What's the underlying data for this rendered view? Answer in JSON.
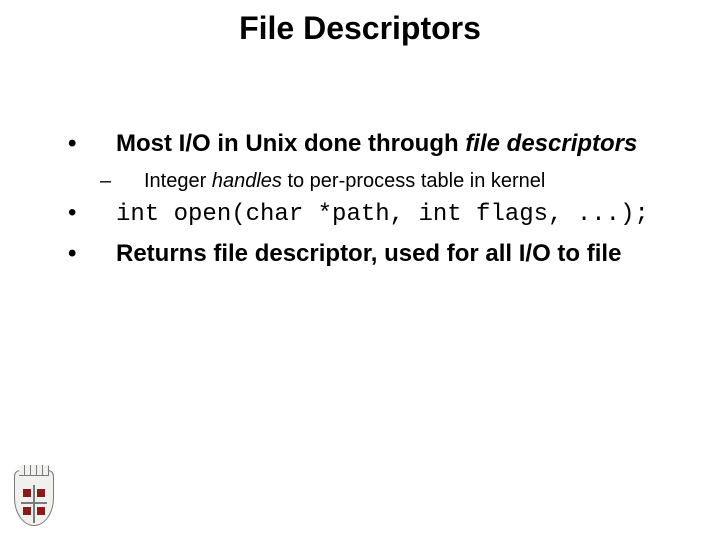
{
  "title": "File Descriptors",
  "bullets": {
    "b1_pre": "Most I/O in Unix done through ",
    "b1_italic": "file descriptors",
    "b2_pre": "Integer ",
    "b2_italic": "handles",
    "b2_post": " to per-process table in kernel",
    "b3_code": "int open(char *path, int flags, ...);",
    "b4": "Returns file descriptor, used for all I/O to file"
  },
  "logo_name": "brown-university-shield"
}
